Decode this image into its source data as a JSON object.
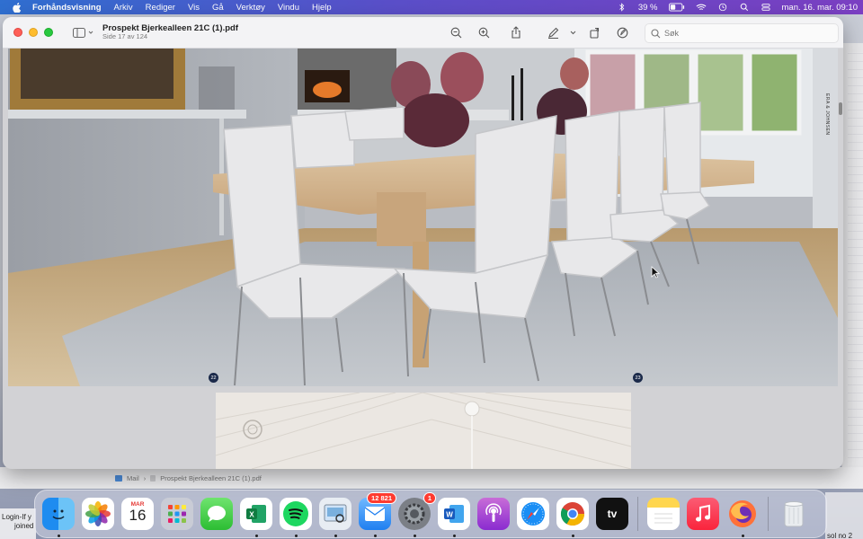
{
  "menubar": {
    "app_name": "Forhåndsvisning",
    "items": [
      "Arkiv",
      "Rediger",
      "Vis",
      "Gå",
      "Verktøy",
      "Vindu",
      "Hjelp"
    ],
    "battery": "39 %",
    "datetime": "man. 16. mar.  09:10"
  },
  "window": {
    "title": "Prospekt Bjerkealleen 21C (1).pdf",
    "subtitle": "Side 17 av 124",
    "search_placeholder": "Søk"
  },
  "document": {
    "page_left_number": "22",
    "page_right_number": "23",
    "side_label": "ERA & JOHNSEN"
  },
  "mail": {
    "breadcrumb_app": "Mail",
    "breadcrumb_file": "Prospekt Bjerkealleen 21C (1).pdf"
  },
  "dock": {
    "calendar_month": "MAR",
    "calendar_day": "16",
    "mail_badge": "12 821",
    "settings_badge": "1",
    "tv_label": "tv"
  },
  "notifications": {
    "left_text_1": "Login-If y",
    "left_text_2": "joined",
    "right_text": "sol no 2"
  },
  "colors": {
    "close": "#fe5f57",
    "minimize": "#febc2e",
    "maximize": "#28c840",
    "badge": "#ff3b30"
  }
}
